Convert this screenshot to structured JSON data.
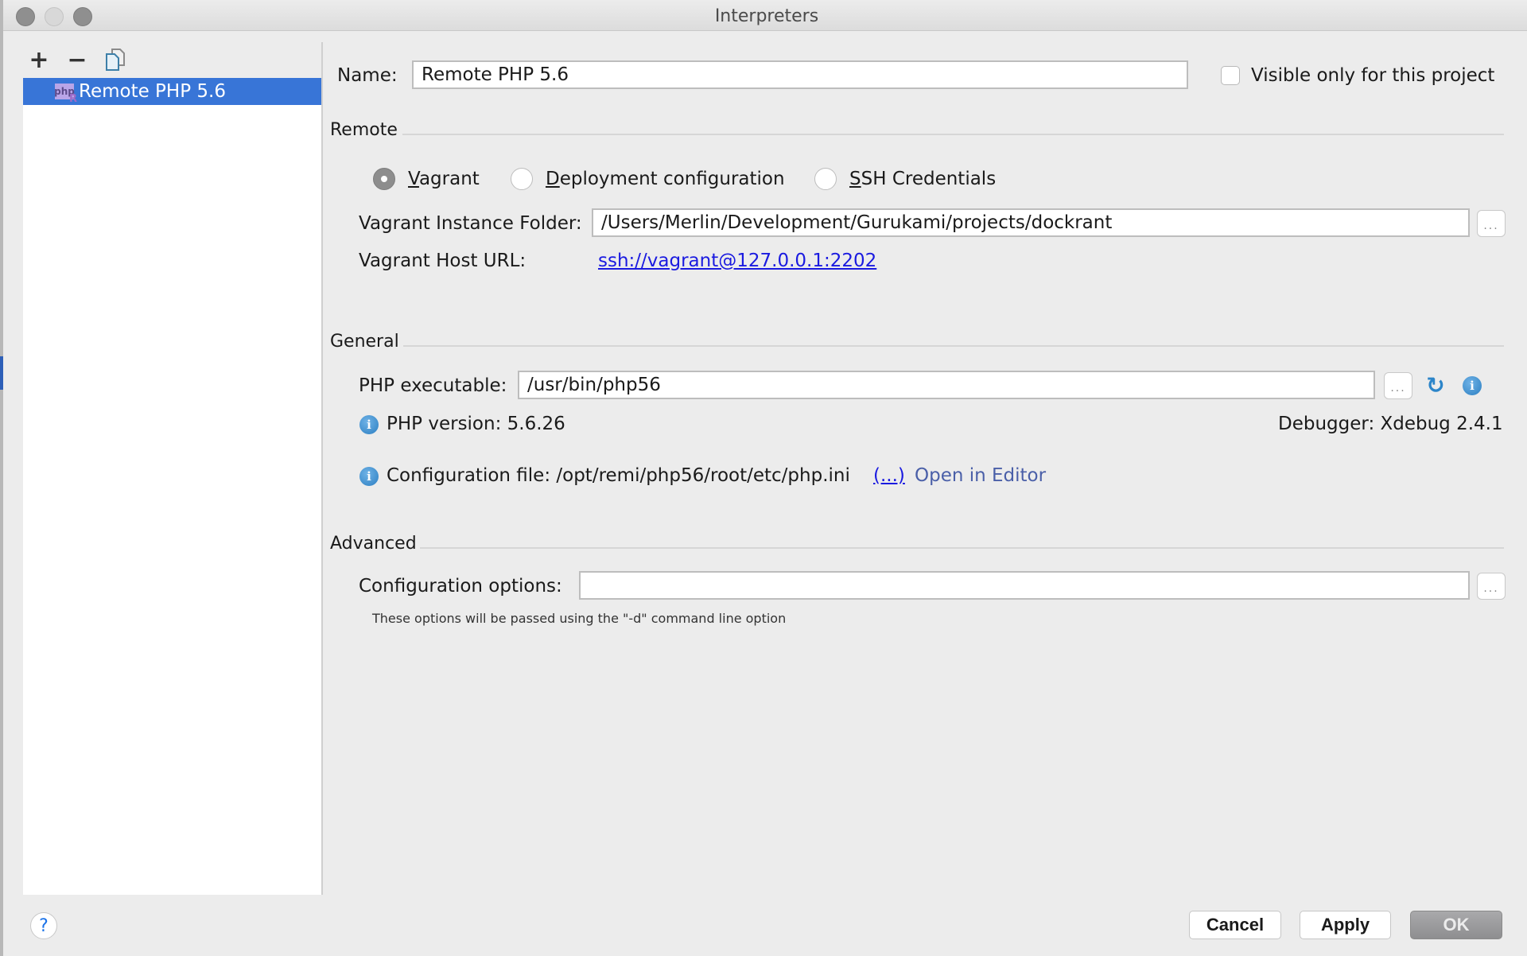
{
  "window": {
    "title": "Interpreters"
  },
  "sidebar": {
    "toolbar": {
      "add": "+",
      "remove": "−"
    },
    "items": [
      {
        "label": "Remote PHP 5.6",
        "icon": "php-remote-icon",
        "icon_text": "php",
        "icon_badge": "R",
        "selected": true
      }
    ]
  },
  "form": {
    "name_label": "Name:",
    "name_value": "Remote PHP 5.6",
    "visible_only_label": "Visible only for this project",
    "visible_only_checked": false,
    "remote": {
      "title": "Remote",
      "options": [
        {
          "mnemonic": "V",
          "rest": "agrant",
          "selected": true
        },
        {
          "mnemonic": "D",
          "rest": "eployment configuration",
          "selected": false
        },
        {
          "mnemonic": "S",
          "rest": "SH Credentials",
          "selected": false
        }
      ],
      "instance_folder_label": "Vagrant Instance Folder:",
      "instance_folder_value": "/Users/Merlin/Development/Gurukami/projects/dockrant",
      "host_url_label": "Vagrant Host URL:",
      "host_url_value": "ssh://vagrant@127.0.0.1:2202"
    },
    "general": {
      "title": "General",
      "php_exec_label": "PHP executable:",
      "php_exec_value": "/usr/bin/php56",
      "php_version": "PHP version: 5.6.26",
      "debugger": "Debugger: Xdebug 2.4.1",
      "config_file": "Configuration file: /opt/remi/php56/root/etc/php.ini",
      "config_file_more": "(...)",
      "open_in_editor": "Open in Editor"
    },
    "advanced": {
      "title": "Advanced",
      "config_options_label": "Configuration options:",
      "config_options_value": "",
      "hint": "These options will be passed using the \"-d\" command line option"
    }
  },
  "buttons": {
    "browse": "...",
    "help": "?",
    "cancel": "Cancel",
    "apply": "Apply",
    "ok": "OK"
  }
}
